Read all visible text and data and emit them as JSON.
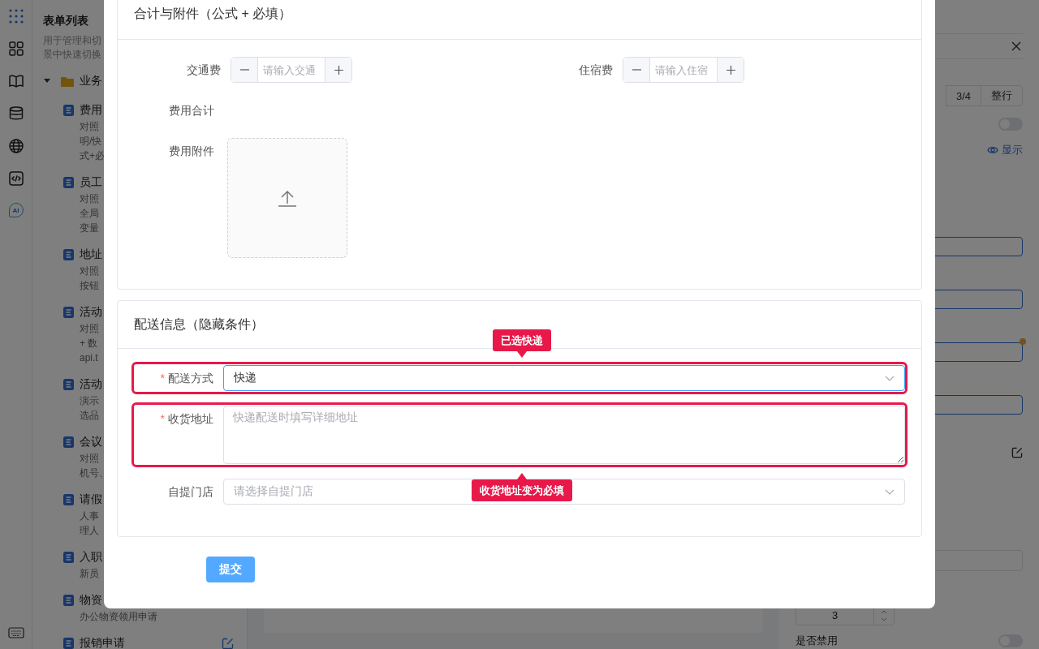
{
  "rail": {
    "ai_label": "AI"
  },
  "sidebar": {
    "title": "表单列表",
    "description_lines": [
      "用于管理和切",
      "景中快速切换"
    ],
    "folder": {
      "label": "业务",
      "expanded": true
    },
    "items": [
      {
        "title": "费用",
        "desc_lines": [
          "对照",
          "明/快",
          "式+必"
        ]
      },
      {
        "title": "员工",
        "desc_lines": [
          "对照",
          "全局",
          "变量"
        ]
      },
      {
        "title": "地址",
        "desc_lines": [
          "对照",
          "按钮"
        ]
      },
      {
        "title": "活动",
        "desc_lines": [
          "对照",
          "+ 数",
          "api.t"
        ]
      },
      {
        "title": "活动",
        "desc_lines": [
          "演示",
          "选品"
        ]
      },
      {
        "title": "会议",
        "desc_lines": [
          "对照",
          "机号、"
        ]
      },
      {
        "title": "请假",
        "desc_lines": [
          "人事",
          "理人"
        ]
      },
      {
        "title": "入职",
        "desc_lines": [
          "新员"
        ]
      },
      {
        "title": "物资",
        "desc_lines": [
          "办公物资领用申请"
        ]
      },
      {
        "title": "报销申请",
        "hovered": true
      }
    ]
  },
  "props_panel": {
    "segments": [
      {
        "label": "3/4",
        "selected": false
      },
      {
        "label": "整行",
        "selected": false
      }
    ],
    "toggle": {
      "on": false
    },
    "visibility_link": "显示",
    "action_buttons": [
      {
        "dot": false
      },
      {
        "dot": false
      },
      {
        "dot": true
      },
      {
        "dot": false
      }
    ],
    "number_value": "3",
    "disabled_label": "是否禁用",
    "disabled_toggle": {
      "on": false
    }
  },
  "modal": {
    "sections": [
      {
        "title": "合计与附件（公式 + 必填）",
        "fields": [
          {
            "kind": "number",
            "label": "交通费",
            "placeholder": "请输入交通"
          },
          {
            "kind": "number",
            "label": "住宿费",
            "placeholder": "请输入住宿"
          },
          {
            "kind": "text",
            "label": "费用合计"
          },
          {
            "kind": "upload",
            "label": "费用附件"
          }
        ]
      },
      {
        "title": "配送信息（隐藏条件）",
        "fields": [
          {
            "kind": "select",
            "label": "配送方式",
            "required_mark": "*",
            "value": "快递",
            "focused": true,
            "highlighted": true,
            "callout": {
              "text": "已选快递"
            }
          },
          {
            "kind": "textarea",
            "label": "收货地址",
            "required_mark": "*",
            "placeholder": "快递配送时填写详细地址",
            "focused": false,
            "highlighted": true,
            "callout": {
              "text": "收货地址变为必填"
            }
          },
          {
            "kind": "select",
            "label": "自提门店",
            "placeholder": "请选择自提门店",
            "focused": false,
            "highlighted": false
          }
        ]
      }
    ],
    "submit": "提交"
  }
}
